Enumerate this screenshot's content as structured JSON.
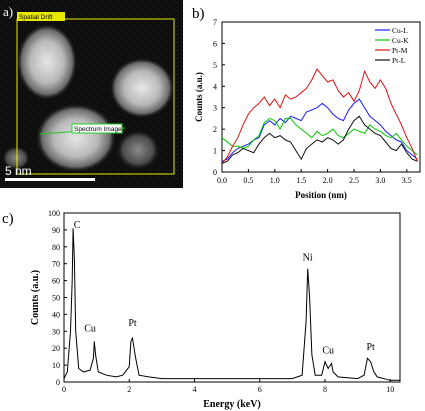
{
  "panel_a": {
    "label": "a)",
    "spatial_drift_label": "Spatial Drift",
    "spectrum_image_label": "Spectrum Image",
    "scale_bar_label": "5 nm",
    "colors": {
      "frame": "#e8e800",
      "line": "#22cc22",
      "scalebar": "#ffffff"
    }
  },
  "chart_data": [
    {
      "panel": "b)",
      "type": "line",
      "xlabel": "Position (nm)",
      "ylabel": "Counts (a.u.)",
      "xlim": [
        0.0,
        3.75
      ],
      "ylim": [
        0,
        7
      ],
      "x_ticks": [
        "0.0",
        "0.5",
        "1.0",
        "1.5",
        "2.0",
        "2.5",
        "3.0",
        "3.5"
      ],
      "y_ticks": [
        "0",
        "1",
        "2",
        "3",
        "4",
        "5",
        "6",
        "7"
      ],
      "legend_position": "top-right",
      "series": [
        {
          "name": "Cu-L",
          "color": "#1a1aff",
          "points": [
            [
              0,
              0.5
            ],
            [
              0.1,
              0.6
            ],
            [
              0.2,
              0.9
            ],
            [
              0.3,
              1.1
            ],
            [
              0.4,
              1.2
            ],
            [
              0.5,
              1.3
            ],
            [
              0.6,
              1.5
            ],
            [
              0.7,
              1.6
            ],
            [
              0.8,
              2.2
            ],
            [
              0.9,
              2.4
            ],
            [
              1.0,
              2.2
            ],
            [
              1.1,
              2.5
            ],
            [
              1.2,
              2.3
            ],
            [
              1.3,
              2.6
            ],
            [
              1.4,
              2.5
            ],
            [
              1.5,
              2.4
            ],
            [
              1.6,
              2.8
            ],
            [
              1.7,
              2.9
            ],
            [
              1.8,
              3.0
            ],
            [
              1.9,
              3.2
            ],
            [
              2.0,
              3.0
            ],
            [
              2.1,
              2.7
            ],
            [
              2.2,
              2.5
            ],
            [
              2.3,
              2.4
            ],
            [
              2.4,
              2.9
            ],
            [
              2.5,
              3.2
            ],
            [
              2.6,
              3.4
            ],
            [
              2.7,
              3.0
            ],
            [
              2.8,
              2.6
            ],
            [
              2.9,
              2.4
            ],
            [
              3.0,
              2.2
            ],
            [
              3.1,
              1.9
            ],
            [
              3.2,
              1.7
            ],
            [
              3.3,
              1.5
            ],
            [
              3.4,
              1.4
            ],
            [
              3.5,
              1.0
            ],
            [
              3.6,
              0.8
            ],
            [
              3.7,
              0.6
            ]
          ]
        },
        {
          "name": "Cu-K",
          "color": "#00cc00",
          "points": [
            [
              0,
              1.6
            ],
            [
              0.1,
              1.4
            ],
            [
              0.2,
              1.2
            ],
            [
              0.3,
              1.2
            ],
            [
              0.4,
              1.1
            ],
            [
              0.5,
              1.2
            ],
            [
              0.6,
              1.5
            ],
            [
              0.7,
              1.7
            ],
            [
              0.8,
              2.3
            ],
            [
              0.9,
              2.5
            ],
            [
              1.0,
              2.4
            ],
            [
              1.1,
              2.0
            ],
            [
              1.2,
              2.5
            ],
            [
              1.3,
              2.5
            ],
            [
              1.4,
              2.2
            ],
            [
              1.5,
              2.0
            ],
            [
              1.6,
              1.8
            ],
            [
              1.7,
              1.6
            ],
            [
              1.8,
              1.9
            ],
            [
              1.9,
              1.7
            ],
            [
              2.0,
              1.8
            ],
            [
              2.1,
              2.0
            ],
            [
              2.2,
              1.7
            ],
            [
              2.3,
              1.6
            ],
            [
              2.4,
              1.8
            ],
            [
              2.5,
              2.0
            ],
            [
              2.6,
              1.9
            ],
            [
              2.7,
              1.8
            ],
            [
              2.8,
              2.2
            ],
            [
              2.9,
              2.0
            ],
            [
              3.0,
              1.9
            ],
            [
              3.1,
              1.7
            ],
            [
              3.2,
              1.6
            ],
            [
              3.3,
              1.8
            ],
            [
              3.4,
              1.5
            ],
            [
              3.5,
              1.2
            ],
            [
              3.6,
              1.0
            ],
            [
              3.7,
              0.8
            ]
          ]
        },
        {
          "name": "Pt-M",
          "color": "#e01010",
          "points": [
            [
              0,
              0.4
            ],
            [
              0.1,
              0.7
            ],
            [
              0.2,
              1.2
            ],
            [
              0.3,
              1.6
            ],
            [
              0.4,
              2.2
            ],
            [
              0.5,
              2.7
            ],
            [
              0.6,
              3.0
            ],
            [
              0.7,
              3.2
            ],
            [
              0.8,
              3.5
            ],
            [
              0.9,
              3.1
            ],
            [
              1.0,
              3.4
            ],
            [
              1.1,
              3.0
            ],
            [
              1.2,
              3.6
            ],
            [
              1.3,
              3.4
            ],
            [
              1.4,
              3.5
            ],
            [
              1.5,
              3.7
            ],
            [
              1.6,
              3.9
            ],
            [
              1.7,
              4.3
            ],
            [
              1.8,
              4.8
            ],
            [
              1.9,
              4.5
            ],
            [
              2.0,
              4.2
            ],
            [
              2.1,
              4.3
            ],
            [
              2.2,
              3.8
            ],
            [
              2.3,
              3.5
            ],
            [
              2.4,
              3.7
            ],
            [
              2.5,
              3.3
            ],
            [
              2.6,
              3.8
            ],
            [
              2.7,
              4.7
            ],
            [
              2.8,
              4.2
            ],
            [
              2.9,
              3.9
            ],
            [
              3.0,
              4.3
            ],
            [
              3.1,
              3.9
            ],
            [
              3.2,
              3.2
            ],
            [
              3.3,
              2.7
            ],
            [
              3.4,
              2.2
            ],
            [
              3.5,
              1.6
            ],
            [
              3.6,
              1.1
            ],
            [
              3.7,
              0.5
            ]
          ]
        },
        {
          "name": "Pt-L",
          "color": "#111111",
          "points": [
            [
              0,
              0.4
            ],
            [
              0.1,
              0.5
            ],
            [
              0.2,
              0.8
            ],
            [
              0.3,
              0.9
            ],
            [
              0.4,
              1.1
            ],
            [
              0.5,
              1.0
            ],
            [
              0.6,
              0.9
            ],
            [
              0.7,
              1.3
            ],
            [
              0.8,
              1.6
            ],
            [
              0.9,
              1.8
            ],
            [
              1.0,
              1.6
            ],
            [
              1.1,
              1.7
            ],
            [
              1.2,
              1.5
            ],
            [
              1.3,
              1.4
            ],
            [
              1.4,
              1.0
            ],
            [
              1.5,
              0.6
            ],
            [
              1.6,
              1.1
            ],
            [
              1.7,
              1.3
            ],
            [
              1.8,
              1.5
            ],
            [
              1.9,
              1.4
            ],
            [
              2.0,
              1.6
            ],
            [
              2.1,
              1.5
            ],
            [
              2.2,
              1.3
            ],
            [
              2.3,
              1.5
            ],
            [
              2.4,
              2.0
            ],
            [
              2.5,
              2.4
            ],
            [
              2.6,
              2.6
            ],
            [
              2.7,
              2.2
            ],
            [
              2.8,
              2.0
            ],
            [
              2.9,
              1.8
            ],
            [
              3.0,
              1.7
            ],
            [
              3.1,
              1.4
            ],
            [
              3.2,
              1.1
            ],
            [
              3.3,
              1.0
            ],
            [
              3.4,
              1.3
            ],
            [
              3.5,
              0.9
            ],
            [
              3.6,
              0.6
            ],
            [
              3.7,
              0.5
            ]
          ]
        }
      ]
    },
    {
      "panel": "c)",
      "type": "line",
      "xlabel": "Energy (keV)",
      "ylabel": "Counts (a.u.)",
      "xlim": [
        0,
        10.3
      ],
      "ylim": [
        0,
        100
      ],
      "x_ticks": [
        "0",
        "2",
        "4",
        "6",
        "8",
        "10"
      ],
      "y_ticks": [
        "0",
        "10",
        "20",
        "30",
        "40",
        "50",
        "60",
        "70",
        "80",
        "90",
        "100"
      ],
      "series": [
        {
          "color": "#000000",
          "points": [
            [
              0,
              2
            ],
            [
              0.1,
              6
            ],
            [
              0.2,
              30
            ],
            [
              0.25,
              60
            ],
            [
              0.28,
              91
            ],
            [
              0.32,
              72
            ],
            [
              0.36,
              30
            ],
            [
              0.45,
              8
            ],
            [
              0.6,
              6
            ],
            [
              0.8,
              7
            ],
            [
              0.9,
              14
            ],
            [
              0.93,
              24
            ],
            [
              0.97,
              16
            ],
            [
              1.05,
              6
            ],
            [
              1.3,
              4
            ],
            [
              1.6,
              3
            ],
            [
              1.8,
              4
            ],
            [
              2.0,
              9
            ],
            [
              2.05,
              24
            ],
            [
              2.1,
              26
            ],
            [
              2.18,
              16
            ],
            [
              2.3,
              4
            ],
            [
              2.6,
              3
            ],
            [
              3.0,
              2
            ],
            [
              3.5,
              2
            ],
            [
              4.0,
              2
            ],
            [
              5.0,
              2
            ],
            [
              6.0,
              2
            ],
            [
              7.0,
              2
            ],
            [
              7.3,
              4
            ],
            [
              7.42,
              36
            ],
            [
              7.47,
              67
            ],
            [
              7.53,
              50
            ],
            [
              7.6,
              16
            ],
            [
              7.7,
              4
            ],
            [
              7.9,
              4
            ],
            [
              8.0,
              12
            ],
            [
              8.05,
              10
            ],
            [
              8.1,
              8
            ],
            [
              8.2,
              11
            ],
            [
              8.25,
              6
            ],
            [
              8.4,
              3
            ],
            [
              9.0,
              2
            ],
            [
              9.2,
              4
            ],
            [
              9.3,
              14
            ],
            [
              9.4,
              12
            ],
            [
              9.5,
              6
            ],
            [
              9.6,
              3
            ],
            [
              10.0,
              1
            ],
            [
              10.3,
              1
            ]
          ]
        }
      ],
      "annotations": [
        {
          "text": "C",
          "x": 0.4,
          "y": 91
        },
        {
          "text": "Cu",
          "x": 0.8,
          "y": 30
        },
        {
          "text": "Pt",
          "x": 2.1,
          "y": 33
        },
        {
          "text": "Ni",
          "x": 7.47,
          "y": 72
        },
        {
          "text": "Cu",
          "x": 8.1,
          "y": 17
        },
        {
          "text": "Pt",
          "x": 9.4,
          "y": 19
        }
      ]
    }
  ]
}
